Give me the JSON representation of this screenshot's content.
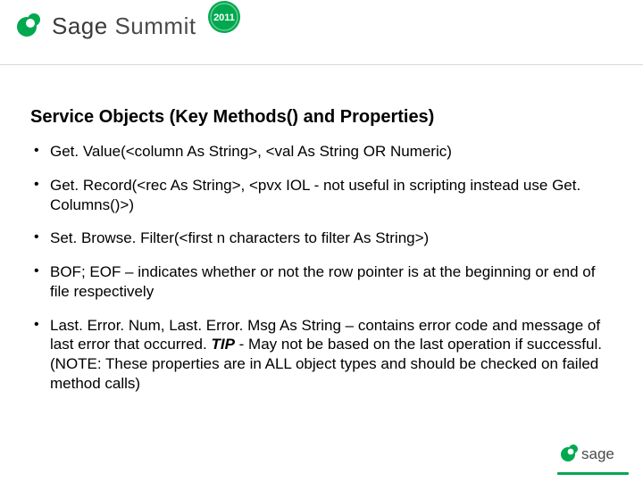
{
  "brand": {
    "sage_word": "Sage",
    "summit_word": "Summit",
    "year": "2011"
  },
  "heading": "Service Objects (Key Methods() and Properties)",
  "bullets": [
    {
      "text": "Get. Value(<column As String>, <val As String OR Numeric)"
    },
    {
      "text": "Get. Record(<rec As String>, <pvx IOL - not useful in scripting instead use Get. Columns()>)"
    },
    {
      "text": "Set. Browse. Filter(<first n characters to filter As String>)"
    },
    {
      "text": "BOF; EOF – indicates whether or not the row pointer is at the beginning or end of file respectively"
    },
    {
      "pre": "Last. Error. Num, Last. Error. Msg As String – contains error code and message of last error that occurred.  ",
      "tip_label": "TIP",
      "mid": " - May not be based on the last operation if successful.  (NOTE: These properties are in ALL object types and should be checked on failed method calls)"
    }
  ],
  "footer": {
    "logo_text": "sage"
  },
  "colors": {
    "sage_green": "#00a94f",
    "dark_text": "#000000"
  }
}
